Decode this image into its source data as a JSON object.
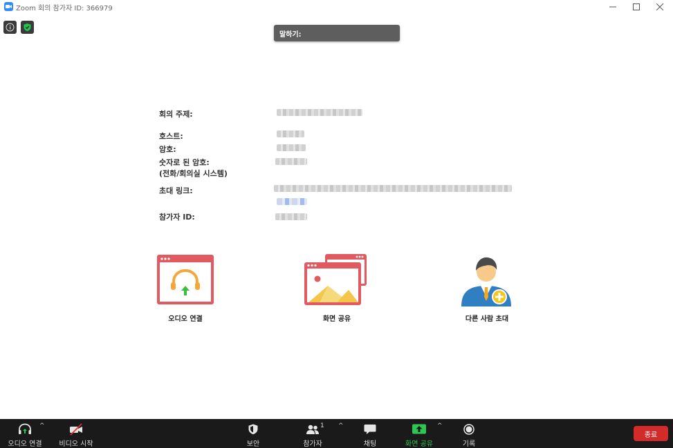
{
  "window": {
    "title": "Zoom 회의 참가자 ID: 366979"
  },
  "speaking": {
    "label": "말하기:"
  },
  "meeting_info": {
    "topic_label": "회의 주제:",
    "host_label": "호스트:",
    "password_label": "암호:",
    "numeric_password_label": "숫자로 된 암호:",
    "numeric_password_sub": "(전화/회의실 시스템)",
    "invite_link_label": "초대 링크:",
    "participant_id_label": "참가자 ID:"
  },
  "actions": {
    "audio": "오디오 연결",
    "share": "화면 공유",
    "invite": "다른 사람 초대"
  },
  "toolbar": {
    "audio": "오디오 연결",
    "video": "비디오 시작",
    "security": "보안",
    "participants": "참가자",
    "participants_count": "1",
    "chat": "채팅",
    "share": "화면 공유",
    "record": "기록",
    "end": "종료"
  },
  "colors": {
    "share_green": "#2dc650",
    "end_red": "#d32a2a",
    "card_red": "#e8585e"
  }
}
